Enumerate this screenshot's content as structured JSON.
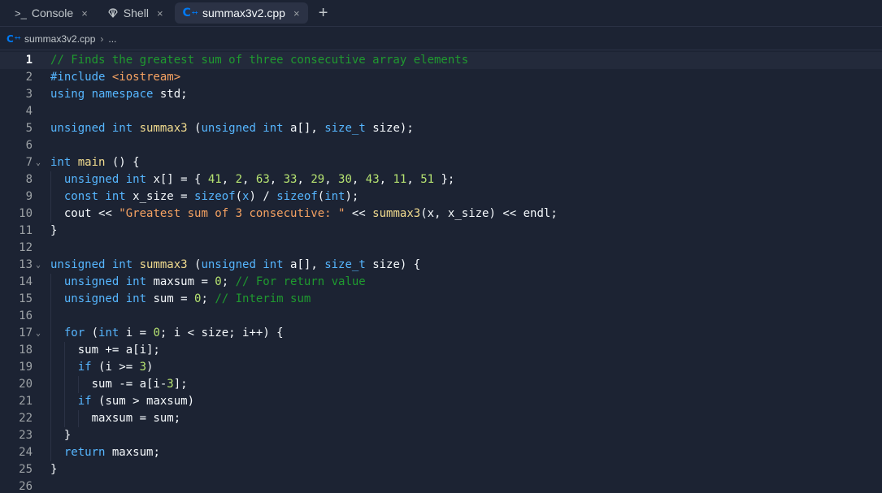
{
  "tabs": [
    {
      "label": "Console",
      "icon": "terminal-icon",
      "glyph": ">_",
      "active": false
    },
    {
      "label": "Shell",
      "icon": "shell-icon",
      "glyph": "🐚",
      "active": false
    },
    {
      "label": "summax3v2.cpp",
      "icon": "cpp-file-icon",
      "glyph": "C",
      "active": true
    }
  ],
  "tab_close_glyph": "×",
  "add_tab_glyph": "+",
  "breadcrumb": {
    "file": "summax3v2.cpp",
    "separator": "›",
    "more": "..."
  },
  "editor": {
    "current_line": 1,
    "lines": [
      {
        "n": "1",
        "fold": false,
        "indent": 0,
        "tokens": [
          [
            "cm",
            "// Finds the greatest sum of three consecutive array elements"
          ]
        ]
      },
      {
        "n": "2",
        "fold": false,
        "indent": 0,
        "tokens": [
          [
            "pre",
            "#include "
          ],
          [
            "inc",
            "<iostream>"
          ]
        ]
      },
      {
        "n": "3",
        "fold": false,
        "indent": 0,
        "tokens": [
          [
            "kw",
            "using namespace "
          ],
          [
            "var",
            "std;"
          ]
        ]
      },
      {
        "n": "4",
        "fold": false,
        "indent": 0,
        "tokens": []
      },
      {
        "n": "5",
        "fold": false,
        "indent": 0,
        "tokens": [
          [
            "kw",
            "unsigned int "
          ],
          [
            "fn",
            "summax3"
          ],
          [
            "var",
            " ("
          ],
          [
            "kw",
            "unsigned int "
          ],
          [
            "var",
            "a[], "
          ],
          [
            "kw",
            "size_t "
          ],
          [
            "var",
            "size);"
          ]
        ]
      },
      {
        "n": "6",
        "fold": false,
        "indent": 0,
        "tokens": []
      },
      {
        "n": "7",
        "fold": true,
        "indent": 0,
        "tokens": [
          [
            "kw",
            "int "
          ],
          [
            "fn",
            "main"
          ],
          [
            "var",
            " () {"
          ]
        ]
      },
      {
        "n": "8",
        "fold": false,
        "indent": 1,
        "tokens": [
          [
            "kw",
            "unsigned int "
          ],
          [
            "var",
            "x[] = { "
          ],
          [
            "num",
            "41"
          ],
          [
            "var",
            ", "
          ],
          [
            "num",
            "2"
          ],
          [
            "var",
            ", "
          ],
          [
            "num",
            "63"
          ],
          [
            "var",
            ", "
          ],
          [
            "num",
            "33"
          ],
          [
            "var",
            ", "
          ],
          [
            "num",
            "29"
          ],
          [
            "var",
            ", "
          ],
          [
            "num",
            "30"
          ],
          [
            "var",
            ", "
          ],
          [
            "num",
            "43"
          ],
          [
            "var",
            ", "
          ],
          [
            "num",
            "11"
          ],
          [
            "var",
            ", "
          ],
          [
            "num",
            "51"
          ],
          [
            "var",
            " };"
          ]
        ]
      },
      {
        "n": "9",
        "fold": false,
        "indent": 1,
        "tokens": [
          [
            "kw",
            "const int "
          ],
          [
            "var",
            "x_size = "
          ],
          [
            "kw",
            "sizeof"
          ],
          [
            "var",
            "("
          ],
          [
            "kw",
            "x"
          ],
          [
            "var",
            ") / "
          ],
          [
            "kw",
            "sizeof"
          ],
          [
            "var",
            "("
          ],
          [
            "kw",
            "int"
          ],
          [
            "var",
            ");"
          ]
        ]
      },
      {
        "n": "10",
        "fold": false,
        "indent": 1,
        "tokens": [
          [
            "var",
            "cout << "
          ],
          [
            "str",
            "\"Greatest sum of 3 consecutive: \""
          ],
          [
            "var",
            " << "
          ],
          [
            "fn",
            "summax3"
          ],
          [
            "var",
            "(x, x_size) << endl;"
          ]
        ]
      },
      {
        "n": "11",
        "fold": false,
        "indent": 0,
        "tokens": [
          [
            "var",
            "}"
          ]
        ]
      },
      {
        "n": "12",
        "fold": false,
        "indent": 0,
        "tokens": []
      },
      {
        "n": "13",
        "fold": true,
        "indent": 0,
        "tokens": [
          [
            "kw",
            "unsigned int "
          ],
          [
            "fn",
            "summax3"
          ],
          [
            "var",
            " ("
          ],
          [
            "kw",
            "unsigned int "
          ],
          [
            "var",
            "a[], "
          ],
          [
            "kw",
            "size_t "
          ],
          [
            "var",
            "size) {"
          ]
        ]
      },
      {
        "n": "14",
        "fold": false,
        "indent": 1,
        "tokens": [
          [
            "kw",
            "unsigned int "
          ],
          [
            "var",
            "maxsum = "
          ],
          [
            "num",
            "0"
          ],
          [
            "var",
            "; "
          ],
          [
            "cm",
            "// For return value"
          ]
        ]
      },
      {
        "n": "15",
        "fold": false,
        "indent": 1,
        "tokens": [
          [
            "kw",
            "unsigned int "
          ],
          [
            "var",
            "sum = "
          ],
          [
            "num",
            "0"
          ],
          [
            "var",
            "; "
          ],
          [
            "cm",
            "// Interim sum"
          ]
        ]
      },
      {
        "n": "16",
        "fold": false,
        "indent": 1,
        "tokens": []
      },
      {
        "n": "17",
        "fold": true,
        "indent": 1,
        "tokens": [
          [
            "kw",
            "for "
          ],
          [
            "var",
            "("
          ],
          [
            "kw",
            "int "
          ],
          [
            "var",
            "i = "
          ],
          [
            "num",
            "0"
          ],
          [
            "var",
            "; i < size; i++) {"
          ]
        ]
      },
      {
        "n": "18",
        "fold": false,
        "indent": 2,
        "tokens": [
          [
            "var",
            "sum += a[i];"
          ]
        ]
      },
      {
        "n": "19",
        "fold": false,
        "indent": 2,
        "tokens": [
          [
            "kw",
            "if "
          ],
          [
            "var",
            "(i >= "
          ],
          [
            "num",
            "3"
          ],
          [
            "var",
            ")"
          ]
        ]
      },
      {
        "n": "20",
        "fold": false,
        "indent": 3,
        "tokens": [
          [
            "var",
            "sum -= a[i-"
          ],
          [
            "num",
            "3"
          ],
          [
            "var",
            "];"
          ]
        ]
      },
      {
        "n": "21",
        "fold": false,
        "indent": 2,
        "tokens": [
          [
            "kw",
            "if "
          ],
          [
            "var",
            "(sum > maxsum)"
          ]
        ]
      },
      {
        "n": "22",
        "fold": false,
        "indent": 3,
        "tokens": [
          [
            "var",
            "maxsum = sum;"
          ]
        ]
      },
      {
        "n": "23",
        "fold": false,
        "indent": 1,
        "tokens": [
          [
            "var",
            "}"
          ]
        ]
      },
      {
        "n": "24",
        "fold": false,
        "indent": 1,
        "tokens": [
          [
            "kw",
            "return "
          ],
          [
            "var",
            "maxsum;"
          ]
        ]
      },
      {
        "n": "25",
        "fold": false,
        "indent": 0,
        "tokens": [
          [
            "var",
            "}"
          ]
        ]
      },
      {
        "n": "26",
        "fold": false,
        "indent": 0,
        "tokens": []
      }
    ]
  },
  "colors": {
    "background": "#1c2333",
    "accent": "#0079f2",
    "keyword": "#56b6ff",
    "function": "#f2dc8f",
    "number": "#b6e371",
    "string": "#f5a262",
    "comment": "#1f9a2f"
  }
}
